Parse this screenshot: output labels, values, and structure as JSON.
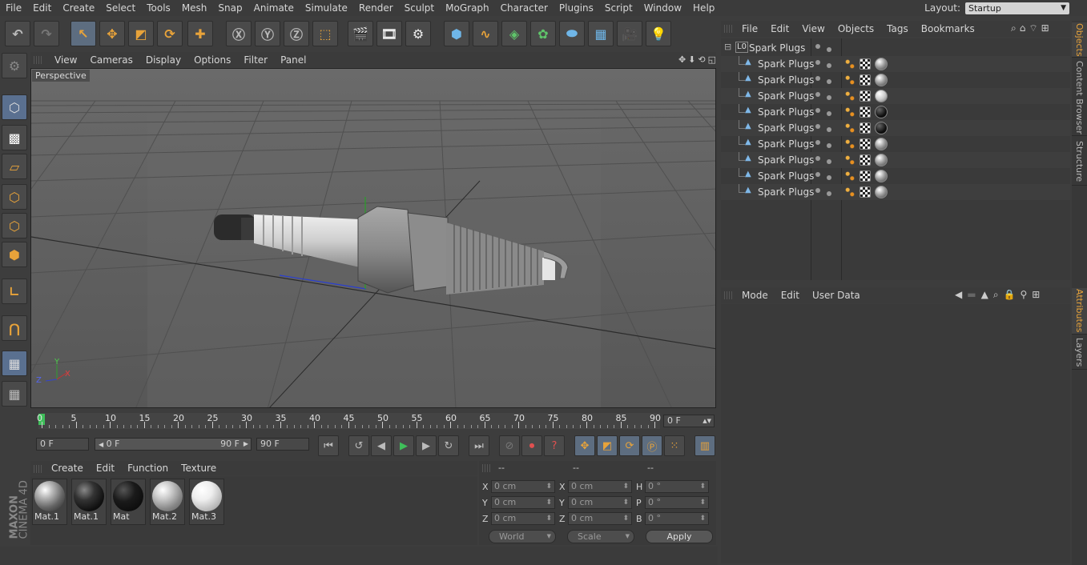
{
  "menubar": {
    "items": [
      "File",
      "Edit",
      "Create",
      "Select",
      "Tools",
      "Mesh",
      "Snap",
      "Animate",
      "Simulate",
      "Render",
      "Sculpt",
      "MoGraph",
      "Character",
      "Plugins",
      "Script",
      "Window",
      "Help"
    ],
    "layout_label": "Layout:",
    "layout_value": "Startup"
  },
  "viewport": {
    "menu": [
      "View",
      "Cameras",
      "Display",
      "Options",
      "Filter",
      "Panel"
    ],
    "label": "Perspective",
    "axis_y": "Y",
    "axis_x": "X",
    "axis_z": "Z"
  },
  "timeline": {
    "ticks": [
      "0",
      "5",
      "10",
      "15",
      "20",
      "25",
      "30",
      "35",
      "40",
      "45",
      "50",
      "55",
      "60",
      "65",
      "70",
      "75",
      "80",
      "85",
      "90"
    ],
    "current_frame": "0 F"
  },
  "transport": {
    "start_field": "0 F",
    "range_start": "0 F",
    "range_end": "90 F",
    "end_field": "90 F"
  },
  "materials": {
    "menu": [
      "Create",
      "Edit",
      "Function",
      "Texture"
    ],
    "items": [
      {
        "name": "Mat.1"
      },
      {
        "name": "Mat.1"
      },
      {
        "name": "Mat"
      },
      {
        "name": "Mat.2"
      },
      {
        "name": "Mat.3"
      }
    ]
  },
  "coords": {
    "headers": [
      "--",
      "--",
      "--"
    ],
    "rows": [
      {
        "l1": "X",
        "v1": "0 cm",
        "l2": "X",
        "v2": "0 cm",
        "l3": "H",
        "v3": "0 °"
      },
      {
        "l1": "Y",
        "v1": "0 cm",
        "l2": "Y",
        "v2": "0 cm",
        "l3": "P",
        "v3": "0 °"
      },
      {
        "l1": "Z",
        "v1": "0 cm",
        "l2": "Z",
        "v2": "0 cm",
        "l3": "B",
        "v3": "0 °"
      }
    ],
    "world": "World",
    "scale": "Scale",
    "apply": "Apply"
  },
  "objects": {
    "menu": [
      "File",
      "Edit",
      "View",
      "Objects",
      "Tags",
      "Bookmarks"
    ],
    "root": "Spark Plugs",
    "children": [
      "Spark Plugs",
      "Spark Plugs",
      "Spark Plugs",
      "Spark Plugs",
      "Spark Plugs",
      "Spark Plugs",
      "Spark Plugs",
      "Spark Plugs",
      "Spark Plugs"
    ]
  },
  "attributes": {
    "menu": [
      "Mode",
      "Edit",
      "User Data"
    ]
  },
  "side_tabs": [
    "Objects",
    "Content Browser",
    "Structure",
    "Attributes",
    "Layers"
  ],
  "brand": {
    "maxon": "MAXON",
    "product": "CINEMA 4D"
  },
  "colors": {
    "accent": "#e8a33a",
    "selected": "#5d6d80",
    "play": "#3fbf5a"
  }
}
